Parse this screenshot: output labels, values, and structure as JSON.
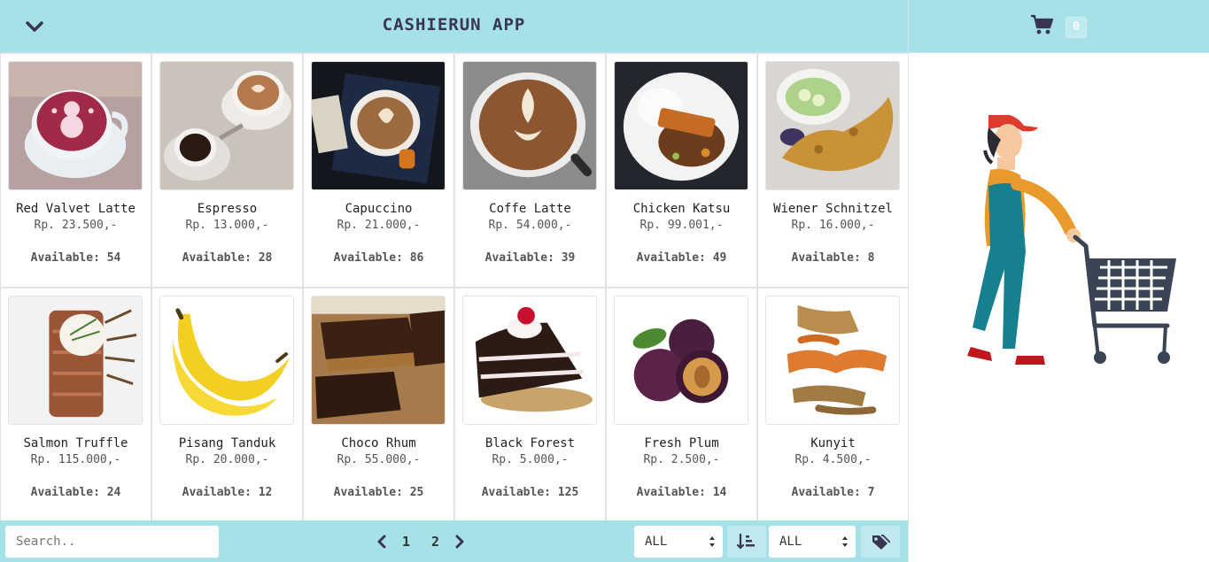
{
  "header": {
    "title": "CASHIERUN APP",
    "toggle_icon": "chevron-down-icon"
  },
  "cart": {
    "icon": "shopping-cart-icon",
    "count": "0"
  },
  "products": [
    {
      "name": "Red Valvet Latte",
      "price": "Rp. 23.500,-",
      "available": "Available: 54"
    },
    {
      "name": "Espresso",
      "price": "Rp. 13.000,-",
      "available": "Available: 28"
    },
    {
      "name": "Capuccino",
      "price": "Rp. 21.000,-",
      "available": "Available: 86"
    },
    {
      "name": "Coffe Latte",
      "price": "Rp. 54.000,-",
      "available": "Available: 39"
    },
    {
      "name": "Chicken Katsu",
      "price": "Rp. 99.001,-",
      "available": "Available: 49"
    },
    {
      "name": "Wiener Schnitzel",
      "price": "Rp. 16.000,-",
      "available": "Available: 8"
    },
    {
      "name": "Salmon Truffle",
      "price": "Rp. 115.000,-",
      "available": "Available: 24"
    },
    {
      "name": "Pisang Tanduk",
      "price": "Rp. 20.000,-",
      "available": "Available: 12"
    },
    {
      "name": "Choco Rhum",
      "price": "Rp. 55.000,-",
      "available": "Available: 25"
    },
    {
      "name": "Black Forest",
      "price": "Rp. 5.000,-",
      "available": "Available: 125"
    },
    {
      "name": "Fresh Plum",
      "price": "Rp. 2.500,-",
      "available": "Available: 14"
    },
    {
      "name": "Kunyit",
      "price": "Rp. 4.500,-",
      "available": "Available: 7"
    }
  ],
  "footer": {
    "search_placeholder": "Search..",
    "pages": [
      "1",
      "2"
    ],
    "sort_select": "ALL",
    "category_select": "ALL",
    "sort_icon": "sort-amount-icon",
    "tag_icon": "tags-icon"
  },
  "colors": {
    "accent": "#a6e1e8",
    "title": "#3b3554",
    "badge": "#bdebf0"
  }
}
